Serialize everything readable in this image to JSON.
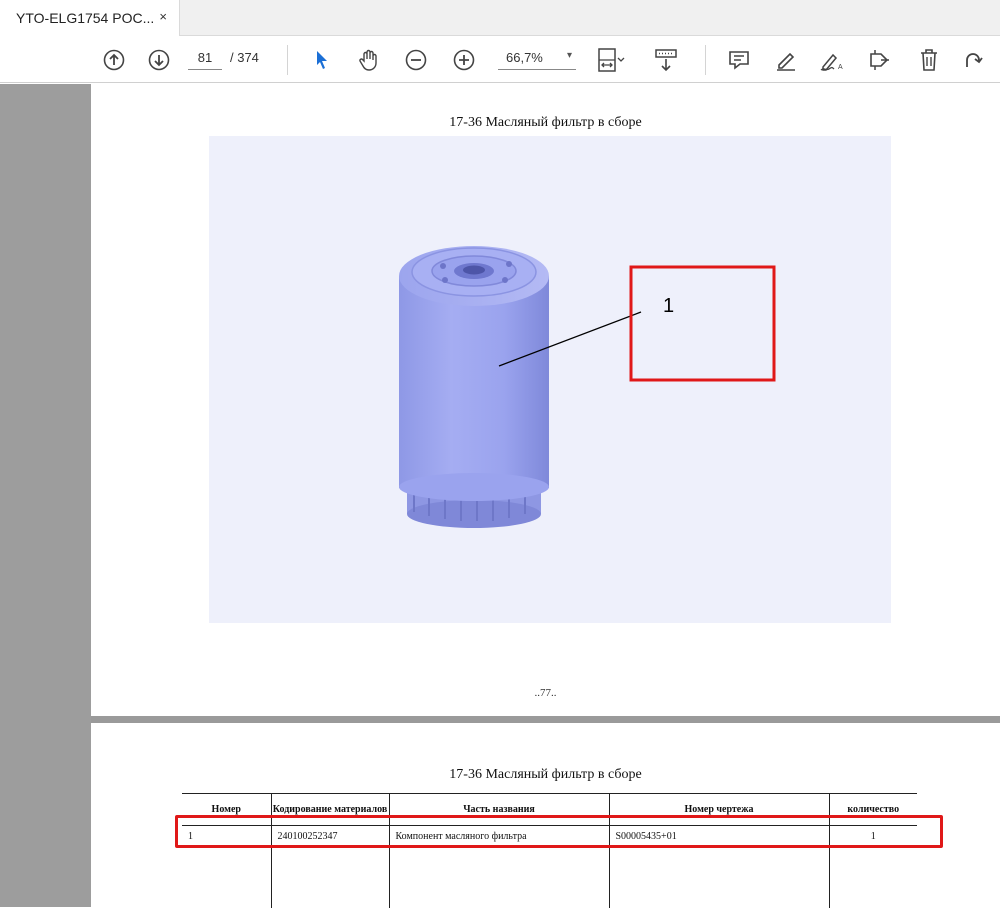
{
  "tab": {
    "title": "YTO-ELG1754 POC...",
    "close": "×"
  },
  "toolbar": {
    "page_current": "81",
    "page_total": "/ 374",
    "zoom": "66,7%",
    "icons": [
      "prev-page-icon",
      "next-page-icon",
      "select-cursor-icon",
      "hand-tool-icon",
      "zoom-out-icon",
      "zoom-in-icon",
      "fit-page-icon",
      "scroll-mode-icon",
      "comment-icon",
      "highlight-icon",
      "sign-icon",
      "stamp-icon",
      "delete-icon",
      "rotate-icon"
    ]
  },
  "document": {
    "page1": {
      "title": "17-36 Масляный фильтр в сборе",
      "callout_label": "1",
      "page_number": "..77..",
      "highlight_color": "#e01818",
      "illustration_bg": "#eef0fb"
    },
    "page2": {
      "title": "17-36 Масляный фильтр в сборе",
      "table": {
        "headers": [
          "Номер",
          "Кодирование материалов",
          "Часть названия",
          "Номер чертежа",
          "количество"
        ],
        "rows": [
          [
            "1",
            "240100252347",
            "Компонент масляного фильтра",
            "S00005435+01",
            "1"
          ]
        ]
      }
    }
  }
}
